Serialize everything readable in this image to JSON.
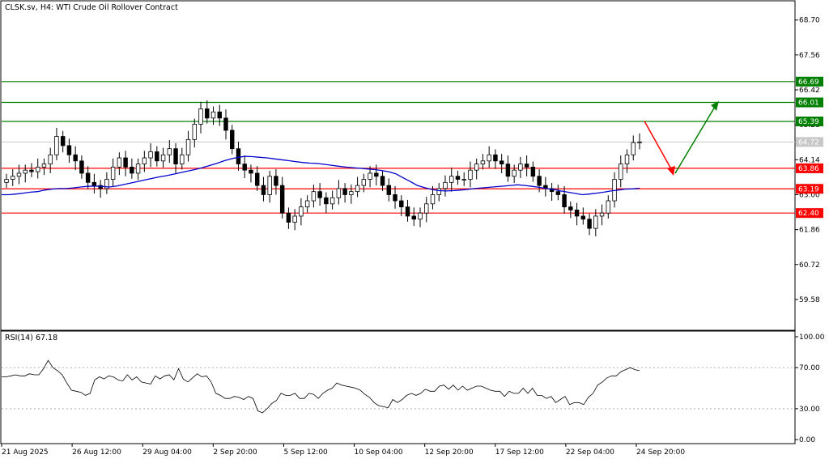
{
  "header": {
    "title": "CLSK.sv, H4:  WTI Crude Oil Rollover Contract"
  },
  "rsi_panel": {
    "title": "RSI(14) 67.18"
  },
  "chart_data": {
    "type": "candlestick",
    "price_axis": {
      "ticks": [
        "68.70",
        "67.56",
        "66.42",
        "65.28",
        "64.14",
        "63.00",
        "61.86",
        "60.72",
        "59.58"
      ],
      "range": [
        58.6,
        69.3
      ]
    },
    "rsi_axis": {
      "ticks": [
        "100.00",
        "70.00",
        "30.00",
        "0.00"
      ],
      "range": [
        0,
        100
      ],
      "levels": [
        70,
        30
      ]
    },
    "x_axis_labels": [
      "21 Aug 2025",
      "26 Aug 12:00",
      "29 Aug 04:00",
      "2 Sep 20:00",
      "5 Sep 12:00",
      "10 Sep 04:00",
      "12 Sep 20:00",
      "17 Sep 12:00",
      "22 Sep 04:00",
      "24 Sep 20:00"
    ],
    "resistance_levels": [
      {
        "value": 66.69,
        "label": "66.69",
        "color": "#008000"
      },
      {
        "value": 66.01,
        "label": "66.01",
        "color": "#008000"
      },
      {
        "value": 65.39,
        "label": "65.39",
        "color": "#008000"
      }
    ],
    "support_levels": [
      {
        "value": 63.86,
        "label": "63.86",
        "color": "#ff0000"
      },
      {
        "value": 63.19,
        "label": "63.19",
        "color": "#ff0000"
      },
      {
        "value": 62.4,
        "label": "62.40",
        "color": "#ff0000"
      }
    ],
    "current_price": {
      "value": 64.72,
      "label": "64.72"
    },
    "close_series": [
      63.5,
      63.6,
      63.7,
      63.8,
      63.75,
      63.9,
      64.0,
      64.3,
      64.9,
      64.6,
      64.3,
      64.1,
      63.7,
      63.4,
      63.3,
      63.2,
      63.5,
      63.9,
      64.2,
      63.9,
      63.7,
      64.0,
      64.2,
      64.4,
      64.1,
      64.3,
      64.5,
      64.0,
      64.3,
      64.8,
      65.3,
      65.8,
      65.5,
      65.7,
      65.5,
      65.1,
      64.5,
      64.0,
      63.8,
      63.7,
      63.3,
      63.0,
      63.6,
      63.3,
      62.4,
      62.1,
      62.3,
      62.6,
      62.8,
      63.1,
      62.9,
      62.7,
      62.9,
      63.2,
      63.0,
      63.1,
      63.3,
      63.5,
      63.7,
      63.6,
      63.3,
      63.0,
      62.8,
      62.6,
      62.3,
      62.2,
      62.4,
      62.7,
      63.0,
      63.2,
      63.4,
      63.6,
      63.5,
      63.5,
      63.8,
      64.0,
      64.1,
      64.3,
      64.1,
      64.0,
      63.6,
      63.8,
      64.0,
      63.9,
      63.6,
      63.3,
      63.2,
      63.1,
      63.0,
      62.6,
      62.5,
      62.3,
      62.2,
      61.9,
      62.3,
      62.4,
      62.8,
      63.5,
      64.0,
      64.3,
      64.7,
      64.72
    ],
    "ma_series": [
      63.0,
      63.0,
      63.02,
      63.05,
      63.08,
      63.1,
      63.15,
      63.18,
      63.2,
      63.2,
      63.22,
      63.25,
      63.27,
      63.28,
      63.27,
      63.25,
      63.28,
      63.33,
      63.38,
      63.43,
      63.48,
      63.53,
      63.58,
      63.62,
      63.67,
      63.72,
      63.77,
      63.82,
      63.88,
      63.95,
      64.02,
      64.1,
      64.17,
      64.22,
      64.25,
      64.24,
      64.22,
      64.2,
      64.17,
      64.14,
      64.11,
      64.08,
      64.05,
      64.03,
      64.02,
      63.99,
      63.96,
      63.93,
      63.9,
      63.88,
      63.86,
      63.84,
      63.82,
      63.79,
      63.75,
      63.68,
      63.55,
      63.43,
      63.3,
      63.23,
      63.17,
      63.13,
      63.12,
      63.13,
      63.15,
      63.17,
      63.2,
      63.22,
      63.24,
      63.26,
      63.28,
      63.3,
      63.32,
      63.3,
      63.27,
      63.24,
      63.2,
      63.17,
      63.12,
      63.08,
      63.04,
      63.0,
      63.02,
      63.05,
      63.08,
      63.12,
      63.15,
      63.18,
      63.19,
      63.21
    ],
    "rsi_series": [
      61,
      61,
      62,
      63,
      62,
      62,
      64,
      63,
      63,
      69,
      77,
      70,
      67,
      63,
      55,
      48,
      47,
      46,
      43,
      45,
      58,
      61,
      59,
      62,
      61,
      58,
      57,
      63,
      58,
      61,
      56,
      55,
      54,
      62,
      59,
      62,
      63,
      58,
      69,
      59,
      56,
      60,
      64,
      61,
      62,
      56,
      45,
      43,
      40,
      40,
      42,
      41,
      39,
      42,
      40,
      28,
      26,
      30,
      35,
      38,
      45,
      43,
      43,
      45,
      40,
      40,
      45,
      44,
      40,
      45,
      48,
      50,
      55,
      53,
      52,
      51,
      50,
      48,
      44,
      41,
      36,
      33,
      32,
      31,
      39,
      36,
      39,
      43,
      45,
      43,
      45,
      49,
      47,
      47,
      52,
      53,
      49,
      53,
      48,
      52,
      48,
      50,
      52,
      52,
      50,
      48,
      47,
      47,
      42,
      47,
      45,
      45,
      50,
      45,
      50,
      43,
      43,
      40,
      42,
      36,
      39,
      42,
      34,
      36,
      36,
      34,
      41,
      45,
      53,
      56,
      60,
      62,
      62,
      66,
      68,
      70,
      68,
      67
    ]
  },
  "forecast": {
    "down_arrow_color": "#ff0000",
    "up_arrow_color": "#008000",
    "path_prices": [
      65.4,
      63.7,
      66.0
    ]
  }
}
